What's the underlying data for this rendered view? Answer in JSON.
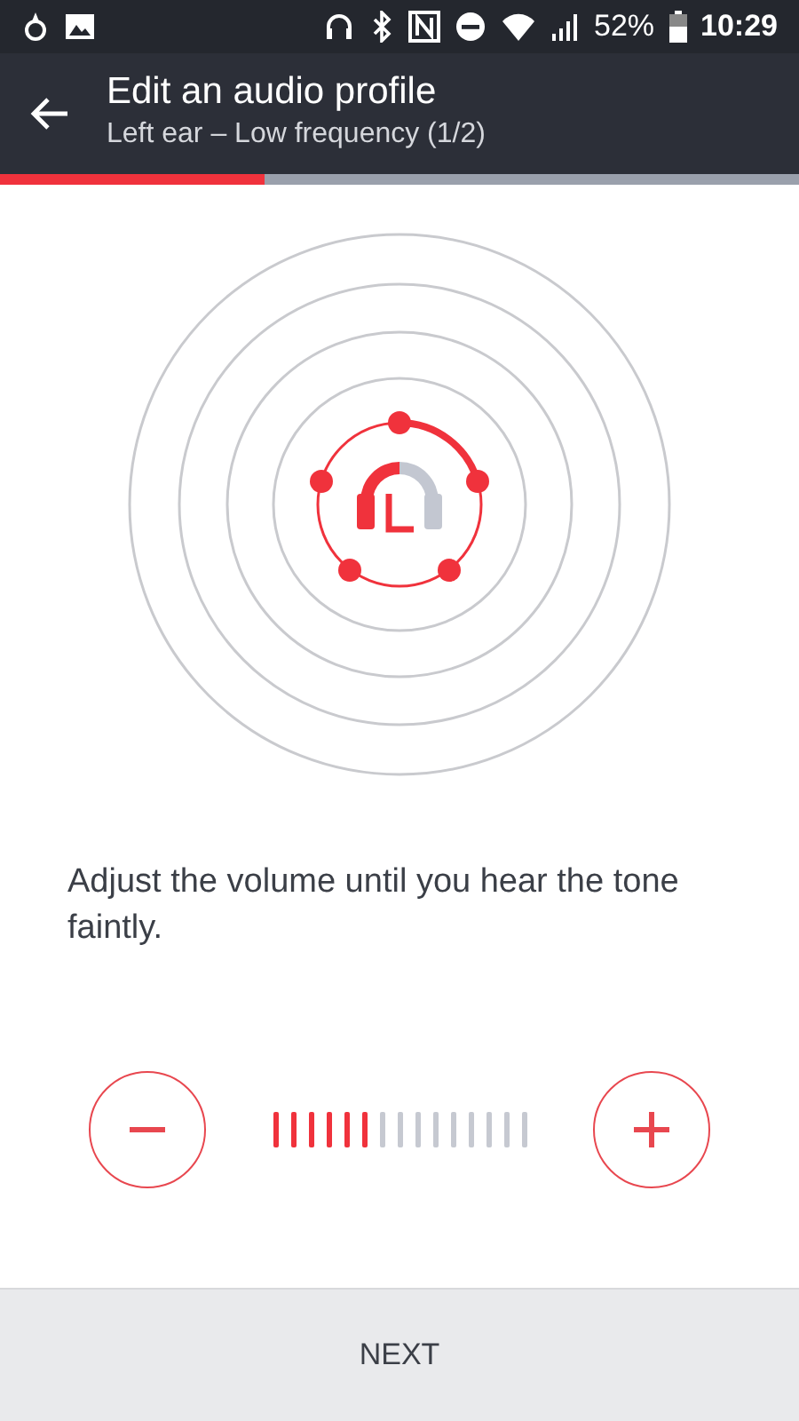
{
  "status_bar": {
    "battery": "52%",
    "time": "10:29"
  },
  "header": {
    "title": "Edit an audio profile",
    "subtitle": "Left ear – Low frequency (1/2)"
  },
  "progress": {
    "level": 0.33
  },
  "instruction": "Adjust the volume until you hear the tone faintly.",
  "volume_ticks": [
    {
      "on": true
    },
    {
      "on": true
    },
    {
      "on": true
    },
    {
      "on": true
    },
    {
      "on": true
    },
    {
      "on": true
    },
    {
      "on": false
    },
    {
      "on": false
    },
    {
      "on": false
    },
    {
      "on": false
    },
    {
      "on": false
    },
    {
      "on": false
    },
    {
      "on": false
    },
    {
      "on": false
    },
    {
      "on": false
    }
  ],
  "footer": {
    "next": "NEXT"
  }
}
